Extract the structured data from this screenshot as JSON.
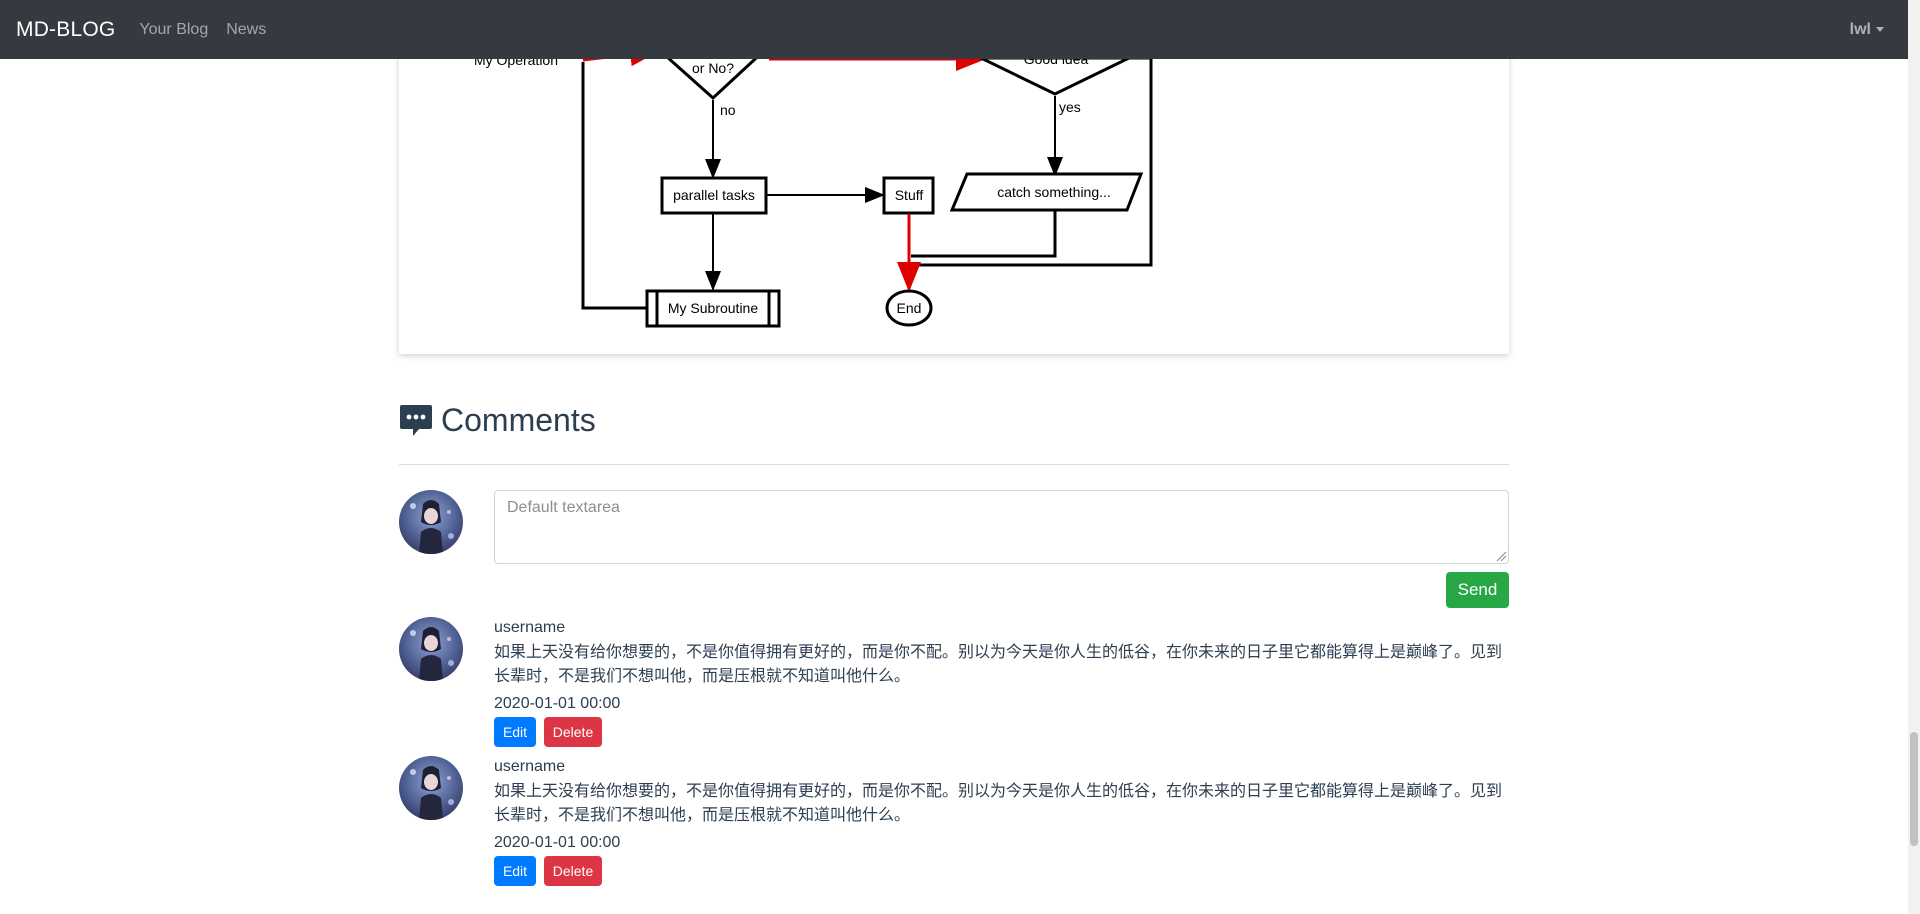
{
  "navbar": {
    "brand": "MD-BLOG",
    "links": [
      "Your Blog",
      "News"
    ],
    "user": "lwl"
  },
  "flowchart": {
    "nodes": {
      "operation": "My Operation",
      "decision1": "or No?",
      "decision2": "Good idea",
      "parallel": "parallel tasks",
      "stuff": "Stuff",
      "catch": "catch something...",
      "subroutine": "My Subroutine",
      "end": "End"
    },
    "edge_labels": {
      "no": "no",
      "yes": "yes"
    }
  },
  "comments": {
    "heading": "Comments",
    "textarea_placeholder": "Default textarea",
    "send_label": "Send",
    "items": [
      {
        "username": "username",
        "text": "如果上天没有给你想要的，不是你值得拥有更好的，而是你不配。别以为今天是你人生的低谷，在你未来的日子里它都能算得上是巅峰了。见到长辈时，不是我们不想叫他，而是压根就不知道叫他什么。",
        "date": "2020-01-01 00:00",
        "edit_label": "Edit",
        "delete_label": "Delete"
      },
      {
        "username": "username",
        "text": "如果上天没有给你想要的，不是你值得拥有更好的，而是你不配。别以为今天是你人生的低谷，在你未来的日子里它都能算得上是巅峰了。见到长辈时，不是我们不想叫他，而是压根就不知道叫他什么。",
        "date": "2020-01-01 00:00",
        "edit_label": "Edit",
        "delete_label": "Delete"
      }
    ]
  },
  "colors": {
    "navbar_bg": "#343a40",
    "send_button": "#28a745",
    "edit_button": "#007bff",
    "delete_button": "#dc3545",
    "flow_highlight": "#ff0000"
  }
}
